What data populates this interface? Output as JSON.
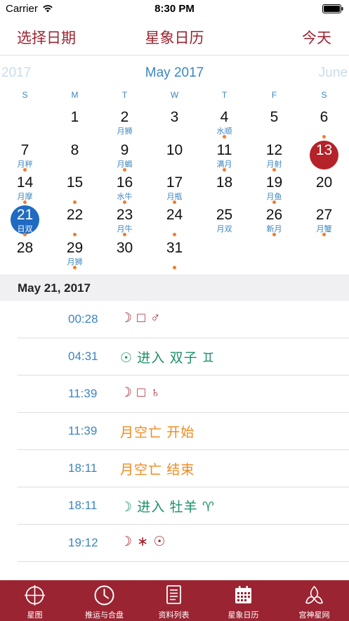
{
  "status_bar": {
    "carrier": "Carrier",
    "time": "8:30 PM"
  },
  "nav": {
    "left": "选择日期",
    "title": "星象日历",
    "right": "今天"
  },
  "calendar": {
    "prev_month": "2017",
    "current_month": "May 2017",
    "next_month": "June",
    "weekdays": [
      "S",
      "M",
      "T",
      "W",
      "T",
      "F",
      "S"
    ],
    "weeks": [
      [
        null,
        {
          "day": "1",
          "sub": "",
          "dot": false
        },
        {
          "day": "2",
          "sub": "月狮",
          "dot": false
        },
        {
          "day": "3",
          "sub": "",
          "dot": false
        },
        {
          "day": "4",
          "sub": "水顺",
          "dot": true
        },
        {
          "day": "5",
          "sub": "",
          "dot": false
        },
        {
          "day": "6",
          "sub": "",
          "dot": true
        }
      ],
      [
        {
          "day": "7",
          "sub": "月秤",
          "dot": true
        },
        {
          "day": "8",
          "sub": "",
          "dot": false
        },
        {
          "day": "9",
          "sub": "月蝎",
          "dot": true
        },
        {
          "day": "10",
          "sub": "",
          "dot": false
        },
        {
          "day": "11",
          "sub": "满月",
          "dot": true
        },
        {
          "day": "12",
          "sub": "月射",
          "dot": true
        },
        {
          "day": "13",
          "sub": "",
          "dot": false,
          "state": "today"
        }
      ],
      [
        {
          "day": "14",
          "sub": "月摩",
          "dot": true
        },
        {
          "day": "15",
          "sub": "",
          "dot": true
        },
        {
          "day": "16",
          "sub": "水牛",
          "dot": true
        },
        {
          "day": "17",
          "sub": "月瓶",
          "dot": true
        },
        {
          "day": "18",
          "sub": "",
          "dot": false
        },
        {
          "day": "19",
          "sub": "月鱼",
          "dot": true
        },
        {
          "day": "20",
          "sub": "",
          "dot": false
        }
      ],
      [
        {
          "day": "21",
          "sub": "日双",
          "dot": true,
          "state": "selected"
        },
        {
          "day": "22",
          "sub": "",
          "dot": true
        },
        {
          "day": "23",
          "sub": "月牛",
          "dot": true
        },
        {
          "day": "24",
          "sub": "",
          "dot": true
        },
        {
          "day": "25",
          "sub": "月双",
          "dot": false
        },
        {
          "day": "26",
          "sub": "新月",
          "dot": true
        },
        {
          "day": "27",
          "sub": "月蟹",
          "dot": true
        }
      ],
      [
        {
          "day": "28",
          "sub": "",
          "dot": false
        },
        {
          "day": "29",
          "sub": "月狮",
          "dot": true
        },
        {
          "day": "30",
          "sub": "",
          "dot": false
        },
        {
          "day": "31",
          "sub": "",
          "dot": true
        },
        null,
        null,
        null
      ]
    ]
  },
  "selected_date": "May 21, 2017",
  "events": [
    {
      "time": "00:28",
      "text": "☽ □ ♂",
      "color": "red"
    },
    {
      "time": "04:31",
      "text": "☉ 进入 双子 ♊",
      "color": "green"
    },
    {
      "time": "11:39",
      "text": "☽ □ ♄",
      "color": "red"
    },
    {
      "time": "11:39",
      "text": "月空亡 开始",
      "color": "orange"
    },
    {
      "time": "18:11",
      "text": "月空亡 结束",
      "color": "orange"
    },
    {
      "time": "18:11",
      "text": "☽ 进入 牡羊 ♈",
      "color": "green"
    },
    {
      "time": "19:12",
      "text": "☽ ∗ ☉",
      "color": "red"
    }
  ],
  "tabs": [
    {
      "label": "星图",
      "icon": "crosshair-chart-icon"
    },
    {
      "label": "推运与合盘",
      "icon": "clock-icon"
    },
    {
      "label": "资料列表",
      "icon": "document-list-icon"
    },
    {
      "label": "星象日历",
      "icon": "calendar-icon"
    },
    {
      "label": "宫神星网",
      "icon": "triquetra-icon"
    }
  ],
  "colors": {
    "brand": "#9b2432",
    "accent_blue": "#3c86c0",
    "today": "#b52229",
    "selected": "#1f6bc2",
    "dot": "#f07c2c",
    "event_red": "#a31f2a",
    "event_green": "#1d8f6b",
    "event_orange": "#ef8a1f"
  }
}
